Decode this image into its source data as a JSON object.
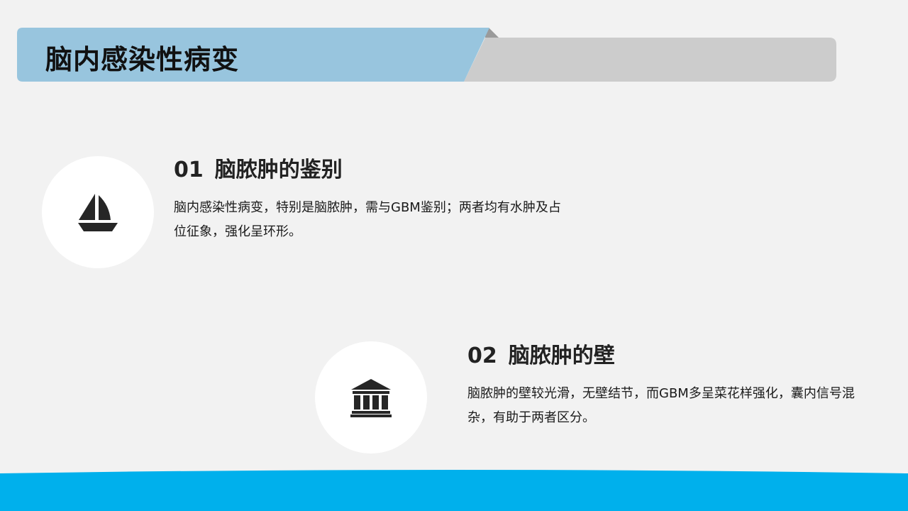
{
  "slide": {
    "title": "脑内感染性病变",
    "colors": {
      "background": "#f2f2f2",
      "title_bar": "#98c5de",
      "title_bar_gray": "#cccccc",
      "icon": "#262626",
      "wave": "#00b0ec"
    }
  },
  "items": [
    {
      "number": "01",
      "heading": "脑脓肿的鉴别",
      "text": "脑内感染性病变，特别是脑脓肿，需与GBM鉴别；两者均有水肿及占位征象，强化呈环形。",
      "icon": "sailboat-icon"
    },
    {
      "number": "02",
      "heading": "脑脓肿的壁",
      "text": "脑脓肿的壁较光滑，无壁结节，而GBM多呈菜花样强化，囊内信号混杂，有助于两者区分。",
      "icon": "bank-building-icon"
    }
  ]
}
